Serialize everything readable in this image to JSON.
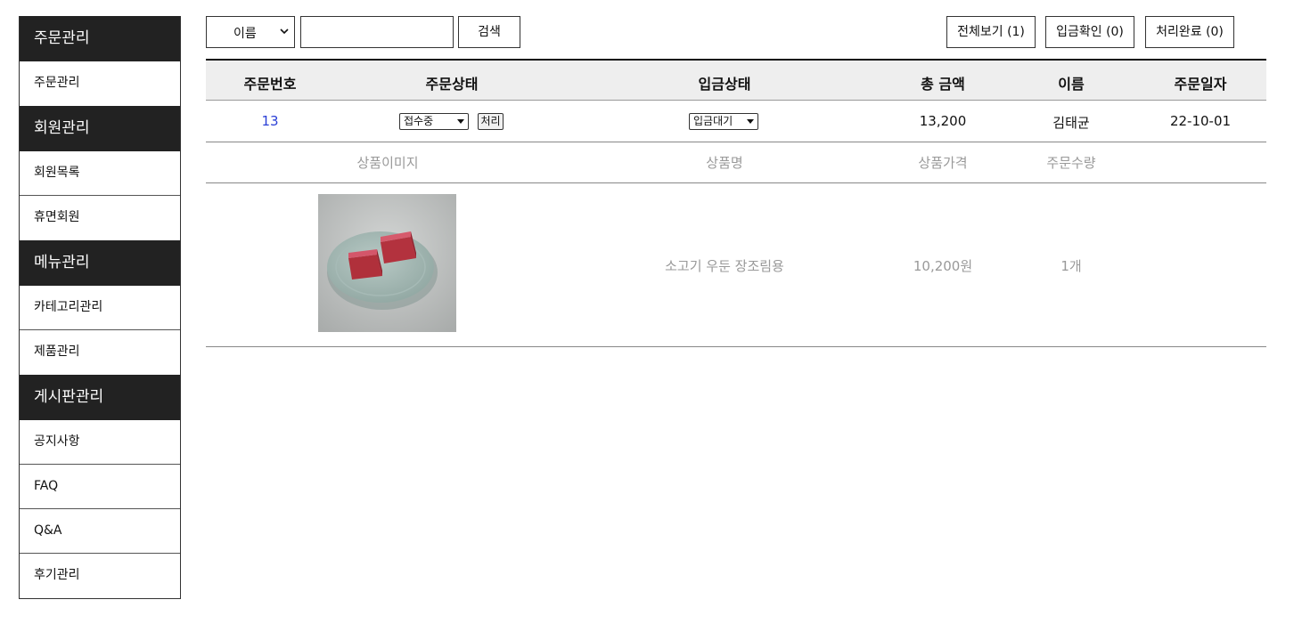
{
  "sidebar": {
    "sections": [
      {
        "title": "주문관리",
        "items": [
          "주문관리"
        ]
      },
      {
        "title": "회원관리",
        "items": [
          "회원목록",
          "휴면회원"
        ]
      },
      {
        "title": "메뉴관리",
        "items": [
          "카테고리관리",
          "제품관리"
        ]
      },
      {
        "title": "게시판관리",
        "items": [
          "공지사항",
          "FAQ",
          "Q&A",
          "후기관리"
        ]
      }
    ]
  },
  "search": {
    "field_selected": "이름",
    "input_value": "",
    "button_label": "검색"
  },
  "filters": {
    "all_label": "전체보기 (1)",
    "deposit_label": "입금확인 (0)",
    "done_label": "처리완료 (0)"
  },
  "table": {
    "headers": [
      "주문번호",
      "주문상태",
      "입금상태",
      "총 금액",
      "이름",
      "주문일자"
    ],
    "orders": [
      {
        "order_no": "13",
        "status_selected": "접수중",
        "process_label": "처리",
        "deposit_selected": "입금대기",
        "total": "13,200",
        "name": "김태균",
        "date": "22-10-01",
        "item_headers": [
          "상품이미지",
          "상품명",
          "상품가격",
          "주문수량"
        ],
        "items": [
          {
            "name": "소고기 우둔 장조림용",
            "price": "10,200원",
            "qty": "1개"
          }
        ]
      }
    ]
  }
}
